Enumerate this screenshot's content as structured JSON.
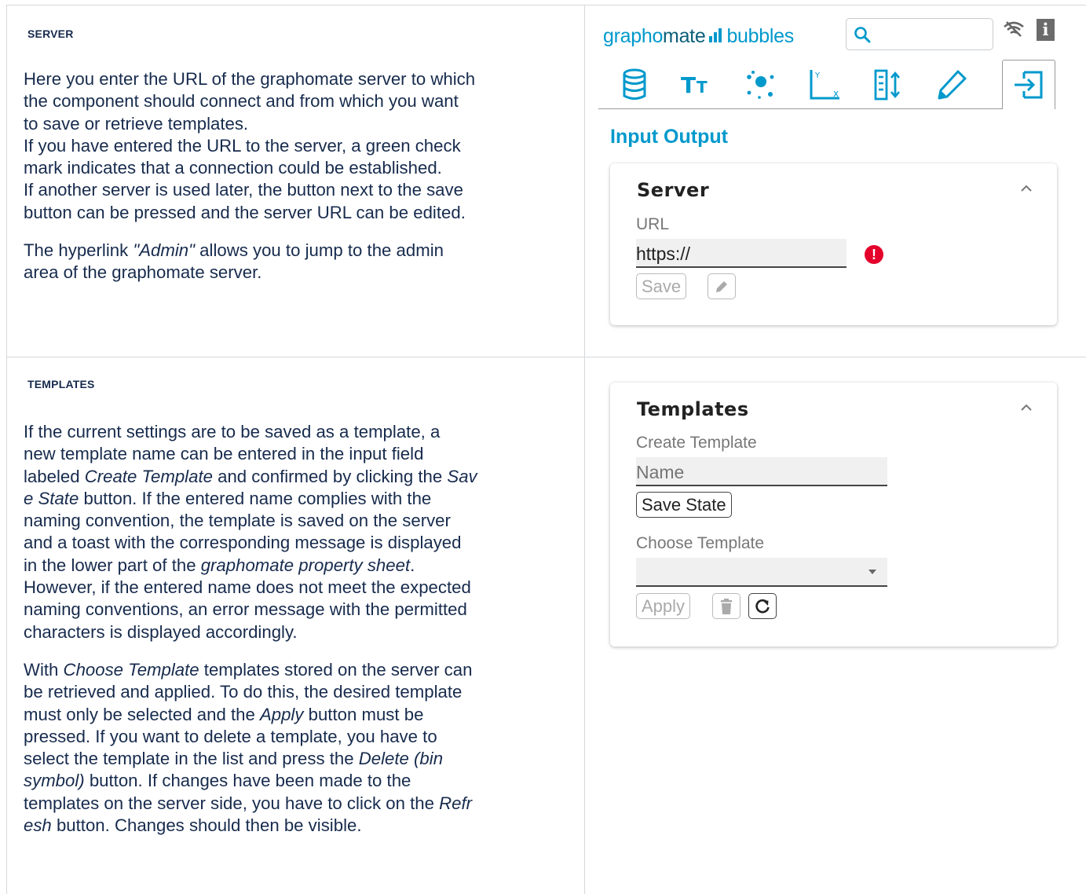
{
  "server_section": {
    "heading": "SERVER",
    "paragraph1": [
      "Here you enter the URL of the graphomate server to which",
      "the component should connect and from which you want",
      "to save or retrieve templates.",
      "If you have entered the URL to the server, a green check",
      "mark indicates that a connection could be established.",
      "If another server is used later, the button next to the save",
      "button can be pressed and the server URL can be edited."
    ],
    "paragraph2": {
      "pre": "The hyperlink ",
      "em": "\"Admin\"",
      "post": " allows you to jump to the admin",
      "line2": "area of the graphomate server."
    }
  },
  "templates_section": {
    "heading": "TEMPLATES",
    "p1": {
      "l1": "If the current settings are to be saved as a template, a",
      "l2": "new template name can be entered in the input field",
      "l3_pre": "labeled ",
      "l3_em1": "Create Template",
      "l3_mid": " and confirmed by clicking the ",
      "l3_em2": "Sav",
      "l4_em": "e State",
      "l4_post": " button. If the entered name complies with the",
      "l5": "naming convention, the template is saved on the server",
      "l6": "and a toast with the corresponding message is displayed",
      "l7_pre": "in the lower part of the ",
      "l7_em": "graphomate property sheet",
      "l7_post": ".",
      "l8": "However, if the entered name does not meet the expected",
      "l9": "naming conventions, an error message with the permitted",
      "l10": "characters is displayed accordingly."
    },
    "p2": {
      "l1_pre": "With ",
      "l1_em": "Choose Template",
      "l1_post": " templates stored on the server can",
      "l2": "be retrieved and applied. To do this, the desired template",
      "l3_pre": "must only be selected and the ",
      "l3_em": "Apply",
      "l3_post": " button must be",
      "l4": "pressed. If you want to delete a template, you have to",
      "l5_pre": "select the template in the list and press the ",
      "l5_em": "Delete (bin",
      "l6_em": "symbol)",
      "l6_post": " button. If changes have been made to the",
      "l7_pre": "templates on the server side, you have to click on the ",
      "l7_em": "Refr",
      "l8_em": "esh",
      "l8_post": " button. Changes should then be visible."
    }
  },
  "property_sheet": {
    "logo_main": "grapho",
    "logo_mate": "mate",
    "logo_product": "bubbles",
    "icons": [
      "search-icon",
      "wifi-off-icon",
      "info-icon"
    ],
    "tabs": [
      "database-tab",
      "text-tab",
      "bubbles-tab",
      "axis-tab",
      "layout-tab",
      "pen-tab",
      "input-output-tab"
    ],
    "active_tab": "input-output-tab",
    "section_title": "Input Output",
    "accent_color": "#0099cc",
    "error_color": "#e4002b",
    "server_card": {
      "title": "Server",
      "url_label": "URL",
      "url_value": "https://",
      "save_label": "Save"
    },
    "templates_card": {
      "title": "Templates",
      "create_label": "Create Template",
      "name_placeholder": "Name",
      "save_state_label": "Save State",
      "choose_label": "Choose Template",
      "apply_label": "Apply"
    }
  }
}
